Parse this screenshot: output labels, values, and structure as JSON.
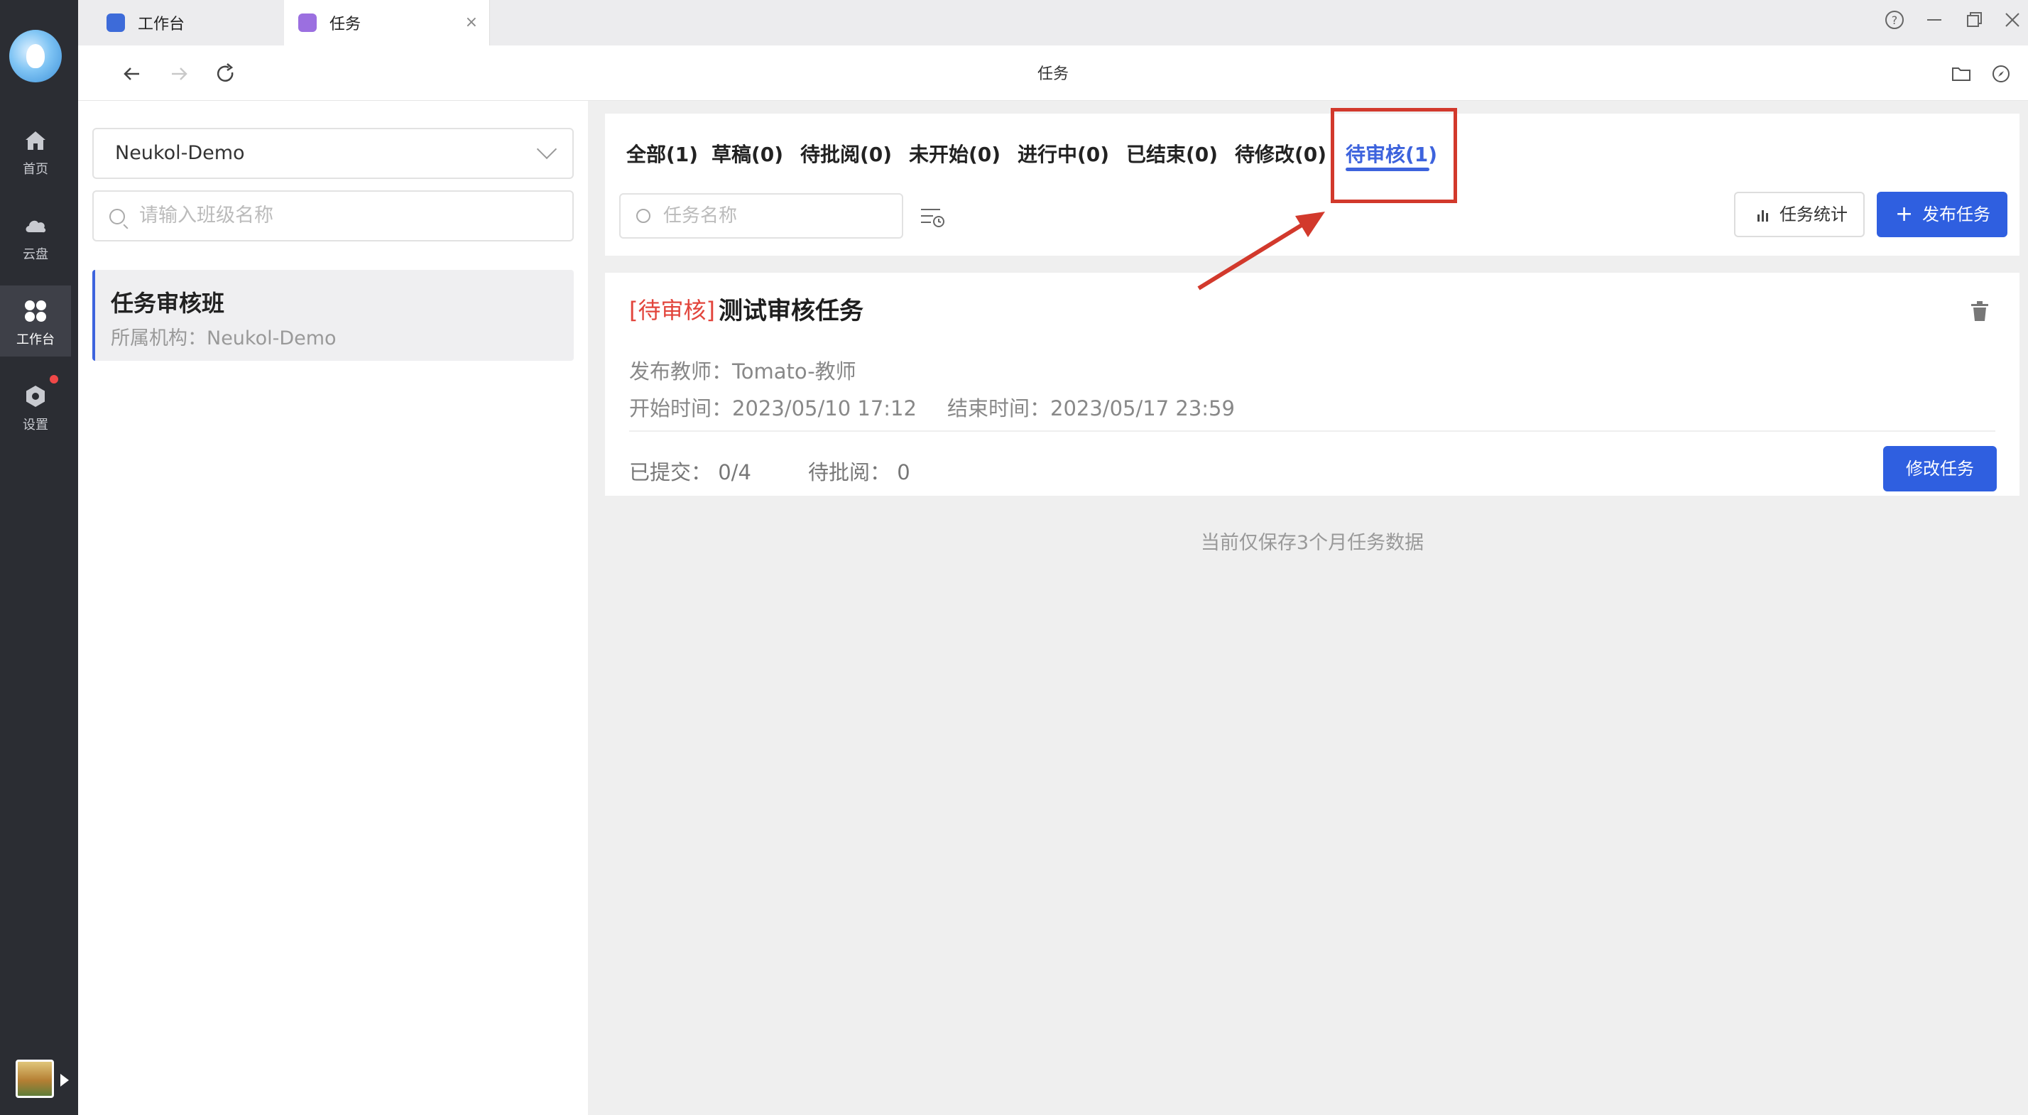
{
  "sidebar": {
    "items": [
      {
        "label": "首页",
        "icon": "home-icon"
      },
      {
        "label": "云盘",
        "icon": "cloud-icon"
      },
      {
        "label": "工作台",
        "icon": "grid-icon"
      },
      {
        "label": "设置",
        "icon": "settings-icon"
      }
    ],
    "active_index": 2
  },
  "tabs": [
    {
      "label": "工作台",
      "icon": "workbench-app-icon"
    },
    {
      "label": "任务",
      "icon": "task-app-icon",
      "close": "×"
    }
  ],
  "navbar": {
    "title": "任务"
  },
  "left_panel": {
    "org_select_value": "Neukol-Demo",
    "class_search_placeholder": "请输入班级名称",
    "class_card": {
      "name": "任务审核班",
      "org": "所属机构：Neukol-Demo"
    }
  },
  "filter_tabs": [
    {
      "label": "全部(1)"
    },
    {
      "label": "草稿(0)"
    },
    {
      "label": "待批阅(0)"
    },
    {
      "label": "未开始(0)"
    },
    {
      "label": "进行中(0)"
    },
    {
      "label": "已结束(0)"
    },
    {
      "label": "待修改(0)"
    },
    {
      "label": "待审核(1)"
    }
  ],
  "active_filter_index": 7,
  "task_search_placeholder": "任务名称",
  "buttons": {
    "stats": "任务统计",
    "publish": "发布任务",
    "edit": "修改任务"
  },
  "task": {
    "status": "[待审核]",
    "title": "测试审核任务",
    "teacher": "发布教师：Tomato-教师",
    "start": "开始时间：2023/05/10 17:12",
    "end": "结束时间：2023/05/17 23:59",
    "submitted": "已提交：  0/4",
    "to_review": "待批阅：  0"
  },
  "footnote": "当前仅保存3个月任务数据",
  "colors": {
    "accent": "#2f5fe0",
    "status_red": "#e2453c",
    "annotation_red": "#d2392c",
    "rail": "#2b2d33"
  }
}
